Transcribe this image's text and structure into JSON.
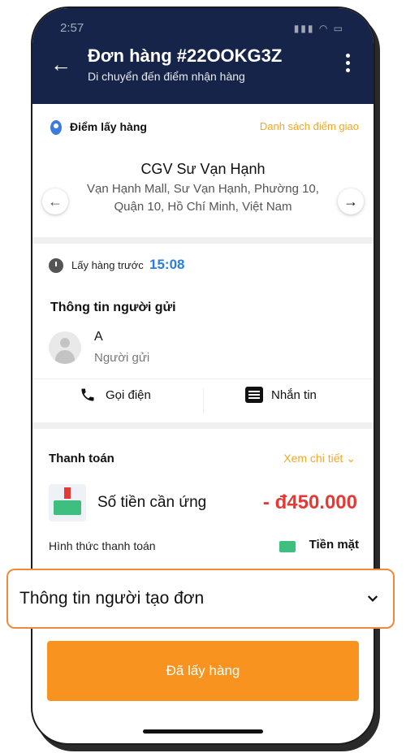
{
  "status": {
    "time": "2:57",
    "icons": "signal wifi battery"
  },
  "header": {
    "title": "Đơn hàng #22OOKG3Z",
    "subtitle": "Di chuyển đến điểm nhận hàng"
  },
  "pickup": {
    "label": "Điểm lấy hàng",
    "dropoff_list": "Danh sách điểm giao",
    "location_name": "CGV Sư Vạn Hạnh",
    "address": "Vạn Hạnh Mall, Sư Vạn Hạnh, Phường 10, Quận 10, Hồ Chí Minh, Việt Nam",
    "pickup_before_label": "Lấy hàng trước",
    "pickup_time": "15:08"
  },
  "sender": {
    "title": "Thông tin người gửi",
    "name": "A",
    "role": "Người gửi"
  },
  "actions": {
    "call": "Gọi điện",
    "message": "Nhắn tin"
  },
  "payment": {
    "title": "Thanh toán",
    "detail_link": "Xem chi tiết",
    "advance_label": "Số tiền cần ứng",
    "advance_amount": "- đ450.000",
    "method_label": "Hình thức thanh toán",
    "method_value": "Tiền mặt"
  },
  "creator": {
    "label": "Thông tin người tạo đơn"
  },
  "primary_button": {
    "label": "Đã lấy hàng"
  },
  "colors": {
    "header_bg": "#16244a",
    "accent_orange": "#f7931e",
    "amount_red": "#e53935",
    "link_blue": "#2a7de1"
  }
}
